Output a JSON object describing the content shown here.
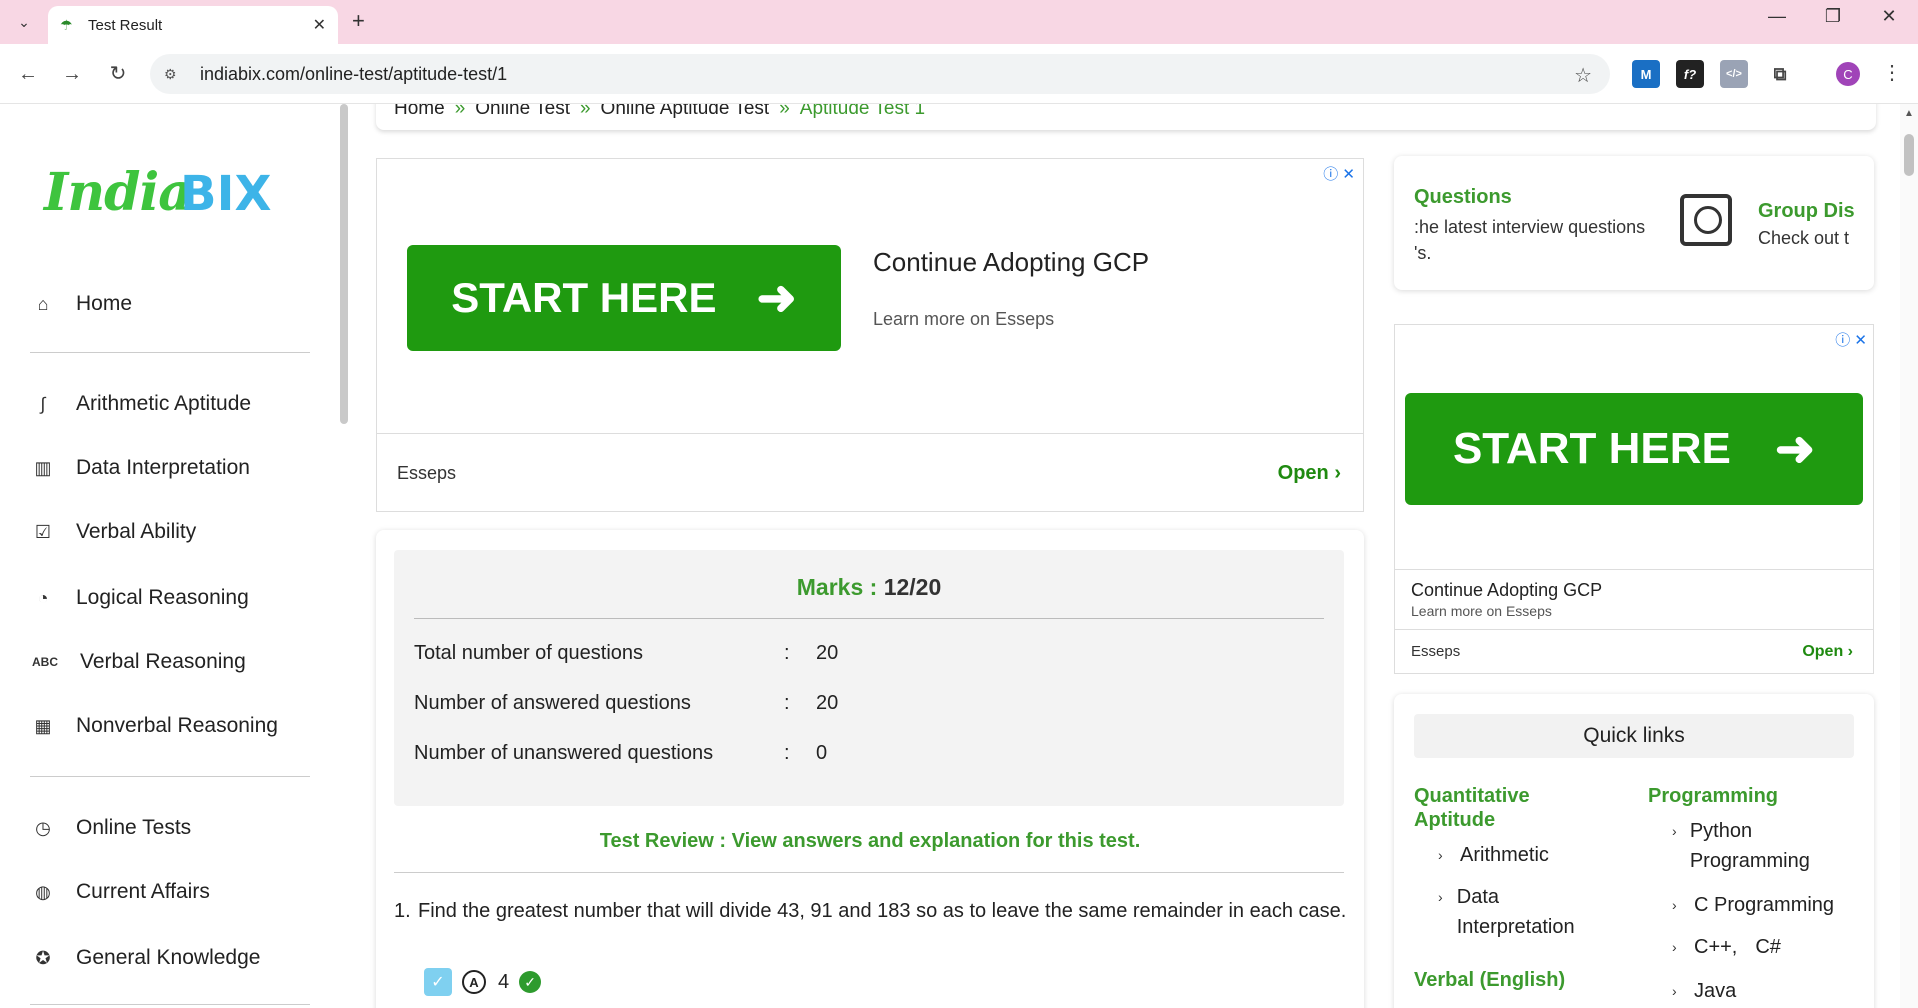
{
  "browser": {
    "tab_title": "Test Result",
    "url": "indiabix.com/online-test/aptitude-test/1",
    "profile_initial": "C"
  },
  "breadcrumb": [
    "Home",
    "Online Test",
    "Online Aptitude Test",
    "Aptitude Test 1"
  ],
  "logo": {
    "part1": "India",
    "part2": "BIX"
  },
  "sidebar": {
    "items": [
      {
        "label": "Home",
        "icon": "home-icon"
      },
      {
        "label": "Arithmetic Aptitude",
        "icon": "integral-icon"
      },
      {
        "label": "Data Interpretation",
        "icon": "bar-chart-icon"
      },
      {
        "label": "Verbal Ability",
        "icon": "checklist-icon"
      },
      {
        "label": "Logical Reasoning",
        "icon": "cycle-icon"
      },
      {
        "label": "Verbal Reasoning",
        "icon": "abc-icon"
      },
      {
        "label": "Nonverbal Reasoning",
        "icon": "dashboard-icon"
      },
      {
        "label": "Online Tests",
        "icon": "clock-icon"
      },
      {
        "label": "Current Affairs",
        "icon": "globe-icon"
      },
      {
        "label": "General Knowledge",
        "icon": "bulb-icon"
      }
    ]
  },
  "ad_main": {
    "button": "START HERE",
    "headline": "Continue Adopting GCP",
    "sub": "Learn more on Esseps",
    "advertiser": "Esseps",
    "open": "Open"
  },
  "result": {
    "marks_label": "Marks :",
    "marks_value": "12/20",
    "stats": [
      {
        "label": "Total number of questions",
        "sep": ":",
        "value": "20"
      },
      {
        "label": "Number of answered questions",
        "sep": ":",
        "value": "20"
      },
      {
        "label": "Number of unanswered questions",
        "sep": ":",
        "value": "0"
      }
    ],
    "review": "Test Review : View answers and explanation for this test.",
    "question_number": "1.",
    "question_text": "Find the greatest number that will divide 43, 91 and 183 so as to leave the same remainder in each case.",
    "answer_letter": "A",
    "answer_value": "4"
  },
  "right_card": {
    "q1_title": "Questions",
    "q1_sub_line1": ":he latest interview questions",
    "q1_sub_line2": "'s.",
    "q2_title": "Group Dis",
    "q2_sub": "Check out t"
  },
  "ad_side": {
    "button": "START HERE",
    "headline": "Continue Adopting GCP",
    "sub": "Learn more on Esseps",
    "advertiser": "Esseps",
    "open": "Open"
  },
  "quick_links": {
    "header": "Quick links",
    "col1_title": "Quantitative Aptitude",
    "col1_items": [
      "Arithmetic",
      "Data Interpretation"
    ],
    "col1_next": "Verbal (English)",
    "col2_title": "Programming",
    "col2_items": [
      "Python Programming",
      "C Programming",
      "C++,",
      "C#",
      "Java"
    ]
  },
  "colors": {
    "accent_green": "#3c9a2e",
    "ad_green": "#1f9a10",
    "tabbar": "#f8d7e4"
  }
}
